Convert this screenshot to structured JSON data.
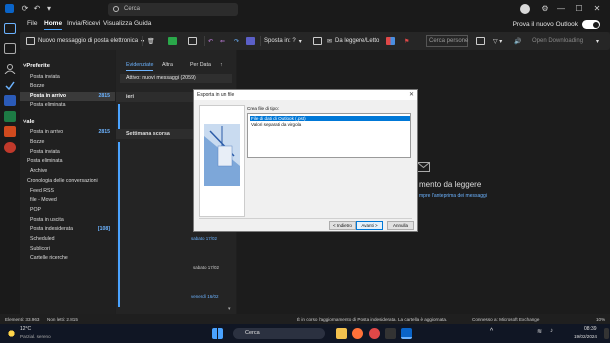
{
  "titlebar": {
    "search_placeholder": "Cerca"
  },
  "menubar": {
    "items": [
      "File",
      "Home",
      "Invia/Ricevi",
      "Visualizza",
      "Guida"
    ],
    "active": "Home",
    "toggle_label": "Prova il nuovo Outlook",
    "toggle_state": "on"
  },
  "ribbon": {
    "new_mail": "Nuovo messaggio di posta elettronica",
    "move_to": "Sposta in: ?",
    "unread_read": "Da leggere/Letto",
    "search_people_placeholder": "Cerca persone",
    "open_download": "Open Downloading"
  },
  "folderpane": {
    "favorites_head": "Preferite",
    "favorites": [
      {
        "label": "Posta inviata"
      },
      {
        "label": "Bozze"
      },
      {
        "label": "Posta in arrivo",
        "count": "2815",
        "selected": true
      },
      {
        "label": "Posta eliminata"
      }
    ],
    "account_head": "ale",
    "account_items": [
      {
        "label": "Posta in arrivo",
        "count": "2815"
      },
      {
        "label": "Bozze"
      },
      {
        "label": "Posta inviata"
      },
      {
        "label": "Posta eliminata"
      },
      {
        "label": "Archive"
      },
      {
        "label": "Cronologia delle conversazioni"
      },
      {
        "label": "Feed RSS"
      },
      {
        "label": "file - Moved"
      },
      {
        "label": "POP"
      },
      {
        "label": "Posta in uscita"
      },
      {
        "label": "Posta indesiderata",
        "count": "[108]"
      },
      {
        "label": "Scheduled"
      },
      {
        "label": "Sublicori"
      },
      {
        "label": "Cartelle ricerche"
      }
    ]
  },
  "msglist": {
    "tab_focused": "Evidenziate",
    "tab_other": "Altra",
    "sort": "Per Data",
    "info": "Attivo: nuovi messaggi (2059)",
    "group_today": "ieri",
    "group_week": "Settimana scorsa",
    "date1": "sabato 17/02",
    "date2": "sabato 17/02",
    "date3": "venerdì 16/02"
  },
  "reading": {
    "empty_title": "mento da leggere",
    "empty_link": "mpre l'anteprima dei messaggi"
  },
  "dialog": {
    "title": "Esporta in un file",
    "prompt": "Crea file di tipo:",
    "options": [
      "File di dati di Outlook (.pst)",
      "Valori separati da virgola"
    ],
    "selected_index": 0,
    "back": "< Indietro",
    "next": "Avanti >",
    "cancel": "Annulla"
  },
  "statusbar": {
    "items": "Elementi: 33.963",
    "unread": "Non letti: 2.815",
    "folder_status": "È in corso l'aggiornamento di Posta indesiderata. La cartella è aggiornata.",
    "connection": "Connesso a: Microsoft Exchange",
    "zoom": "10%"
  },
  "taskbar": {
    "weather_temp": "12°C",
    "weather_desc": "Parzial. sereno",
    "search": "Cerca",
    "time": "08:39",
    "date": "19/02/2024"
  },
  "colors": {
    "accent": "#4aa3ff",
    "dialog_selection": "#0078d7"
  }
}
